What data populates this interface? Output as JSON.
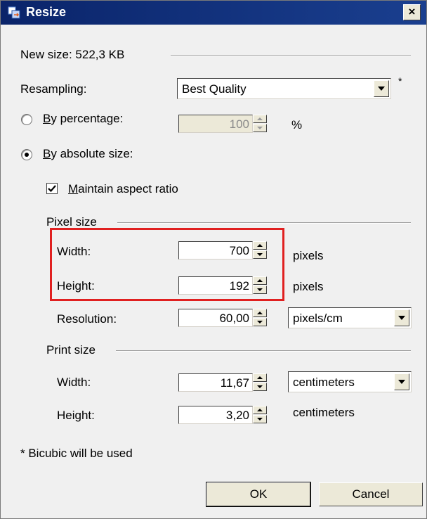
{
  "window": {
    "title": "Resize",
    "close_label": "×"
  },
  "new_size": {
    "label": "New size: 522,3 KB"
  },
  "resampling": {
    "label": "Resampling:",
    "value": "Best Quality",
    "asterisk": "*"
  },
  "by_percentage": {
    "label": "By percentage:",
    "value": "100",
    "unit": "%",
    "selected": false
  },
  "by_absolute": {
    "label": "By absolute size:",
    "selected": true
  },
  "maintain_aspect": {
    "label": "Maintain aspect ratio",
    "checked": true
  },
  "pixel_size": {
    "group_label": "Pixel size",
    "width_label": "Width:",
    "width_value": "700",
    "width_unit": "pixels",
    "height_label": "Height:",
    "height_value": "192",
    "height_unit": "pixels",
    "resolution_label": "Resolution:",
    "resolution_value": "60,00",
    "resolution_unit": "pixels/cm"
  },
  "print_size": {
    "group_label": "Print size",
    "width_label": "Width:",
    "width_value": "11,67",
    "width_unit": "centimeters",
    "height_label": "Height:",
    "height_value": "3,20",
    "height_unit": "centimeters"
  },
  "footnote": "* Bicubic will be used",
  "buttons": {
    "ok": "OK",
    "cancel": "Cancel"
  },
  "colors": {
    "titlebar": "#0a246a",
    "highlight": "#e02020",
    "background": "#f0f0f0"
  }
}
